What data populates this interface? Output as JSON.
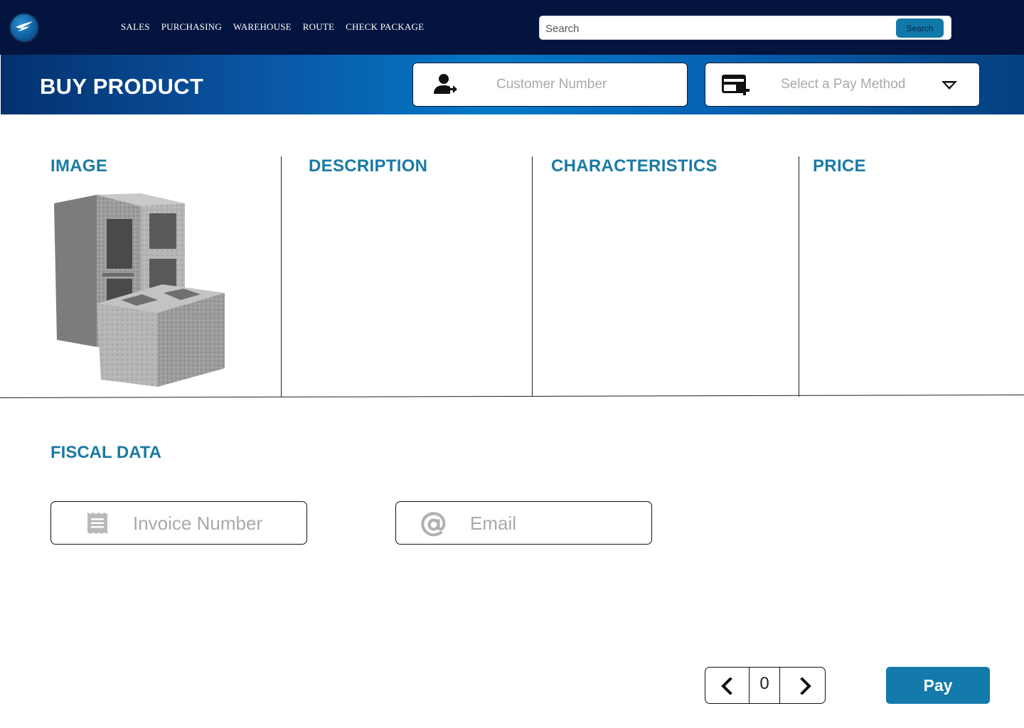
{
  "nav": {
    "items": [
      "SALES",
      "PURCHASING",
      "WAREHOUSE",
      "ROUTE",
      "CHECK PACKAGE"
    ],
    "search": {
      "placeholder": "Search",
      "button_label": "Search"
    }
  },
  "header": {
    "title": "BUY PRODUCT",
    "customer_placeholder": "Customer Number",
    "pay_method_placeholder": "Select a Pay Method"
  },
  "product": {
    "columns": {
      "image": "IMAGE",
      "description": "DESCRIPTION",
      "characteristics": "CHARACTERISTICS",
      "price": "PRICE"
    }
  },
  "fiscal": {
    "title": "FISCAL DATA",
    "invoice_placeholder": "Invoice Number",
    "email_placeholder": "Email"
  },
  "pager": {
    "current": "0"
  },
  "actions": {
    "pay_label": "Pay"
  },
  "icons": {
    "logo": "bird-logo-icon",
    "customer": "person-arrow-icon",
    "pay_method": "card-add-icon",
    "dropdown": "caret-down-icon",
    "invoice": "receipt-icon",
    "email": "at-sign-icon",
    "prev": "chevron-left-icon",
    "next": "chevron-right-icon"
  },
  "colors": {
    "topbar": "#03153f",
    "accent": "#1a7aa6",
    "pay_button": "#137aab"
  }
}
